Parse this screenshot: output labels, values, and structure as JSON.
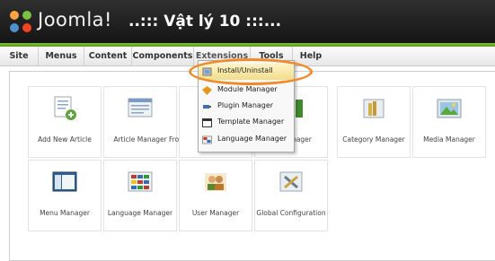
{
  "header": {
    "brand": "Joomla!",
    "site_title": "..::: Vật lý 10 :::..."
  },
  "menu": {
    "items": [
      {
        "label": "Site"
      },
      {
        "label": "Menus"
      },
      {
        "label": "Content"
      },
      {
        "label": "Components"
      },
      {
        "label": "Extensions"
      },
      {
        "label": "Tools"
      },
      {
        "label": "Help"
      }
    ]
  },
  "tiles": {
    "add_article": "Add New Article",
    "article_manager": "Article Manager",
    "front_partial": "Fro",
    "section_partial": "Manager",
    "category_manager": "Category Manager",
    "media_manager": "Media Manager",
    "menu_manager": "Menu Manager",
    "language_manager": "Language Manager",
    "user_manager": "User Manager",
    "global_configuration": "Global Configuration"
  },
  "extensions_dropdown": {
    "items": [
      {
        "label": "Install/Uninstall",
        "icon": "install-icon",
        "highlighted": true
      },
      {
        "label": "Module Manager",
        "icon": "module-icon"
      },
      {
        "label": "Plugin Manager",
        "icon": "plugin-icon"
      },
      {
        "label": "Template Manager",
        "icon": "template-icon"
      },
      {
        "label": "Language Manager",
        "icon": "language-icon"
      }
    ]
  },
  "colors": {
    "header_bg": "#1f1f1f",
    "accent_green": "#6aad28",
    "highlight_ring": "#f08b2c"
  }
}
